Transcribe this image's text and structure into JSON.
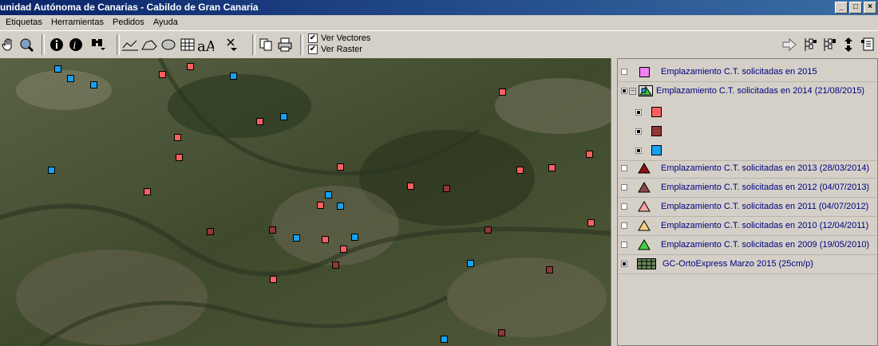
{
  "window": {
    "title": "unidad Autónoma de Canarias - Cabildo de Gran Canaria",
    "buttons": [
      "_",
      "□",
      "×"
    ]
  },
  "menu": [
    "Etiquetas",
    "Herramientas",
    "Pedidos",
    "Ayuda"
  ],
  "toolbar": {
    "ver_vectores": "Ver Vectores",
    "ver_raster": "Ver Raster",
    "ver_vectores_checked": true,
    "ver_raster_checked": true
  },
  "legend": {
    "layers": [
      {
        "label": "Emplazamiento C.T. solicitadas en 2015",
        "symbol": "pink-square",
        "color": "#f080f0",
        "checked": false
      },
      {
        "label": "Emplazamiento C.T. solicitadas en 2014 (21/08/2015)",
        "symbol": "multi-class",
        "checked": true,
        "expanded": true
      },
      {
        "label": "Emplazamiento C.T. solicitadas en 2013 (28/03/2014)",
        "symbol": "triangle",
        "color": "#8b1010",
        "checked": false
      },
      {
        "label": "Emplazamiento C.T. solicitadas en 2012 (04/07/2013)",
        "symbol": "triangle",
        "color": "#8a4a4a",
        "checked": false
      },
      {
        "label": "Emplazamiento C.T. solicitadas en 2011 (04/07/2012)",
        "symbol": "triangle",
        "color": "#f8a0a0",
        "checked": false
      },
      {
        "label": "Emplazamiento C.T. solicitadas en 2010 (12/04/2011)",
        "symbol": "triangle",
        "color": "#f8d080",
        "checked": false
      },
      {
        "label": "Emplazamiento C.T. solicitadas en 2009 (19/05/2010)",
        "symbol": "triangle",
        "color": "#40d040",
        "checked": false
      },
      {
        "label": "GC-OrtoExpress Marzo 2015 (25cm/p)",
        "symbol": "raster-grid",
        "checked": true
      }
    ],
    "sub_classes": [
      {
        "color": "#f86060",
        "checked": true
      },
      {
        "color": "#8f3636",
        "checked": true
      },
      {
        "color": "#18a0f0",
        "checked": true
      }
    ]
  },
  "colors": {
    "red_marker": "#f86060",
    "brown_marker": "#8f3636",
    "blue_marker": "#18a0f0"
  }
}
